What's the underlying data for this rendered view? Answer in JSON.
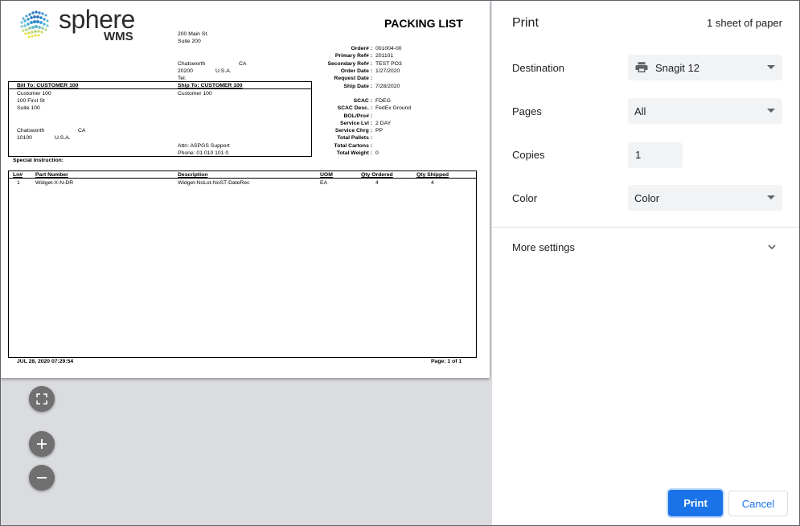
{
  "document": {
    "logo_text": "sphere",
    "logo_sub": "WMS",
    "title": "PACKING LIST",
    "address": {
      "line1": "200 Main St.",
      "line2": "Suite 200",
      "city": "Chatsworth",
      "state": "CA",
      "zip": "20200",
      "country": "U.S.A.",
      "tel_label": "Tel:"
    },
    "fields": [
      {
        "label": "Order# :",
        "value": "001004-00"
      },
      {
        "label": "Primary Ref# :",
        "value": "201101"
      },
      {
        "label": "Secondary Ref# :",
        "value": "TEST PO3"
      },
      {
        "label": "Order Date :",
        "value": "1/27/2020"
      },
      {
        "label": "Request Date :",
        "value": ""
      },
      {
        "label": "Ship Date :",
        "value": "7/28/2020"
      },
      {
        "label": "SCAC :",
        "value": "FDEG"
      },
      {
        "label": "SCAC Desc. :",
        "value": "FedEx Ground"
      },
      {
        "label": "BOL/Pro# :",
        "value": ""
      },
      {
        "label": "Service Lvl :",
        "value": "2 DAY"
      },
      {
        "label": "Service Chrg :",
        "value": "PP"
      },
      {
        "label": "Total Pallets :",
        "value": ""
      },
      {
        "label": "Total Cartons :",
        "value": ""
      },
      {
        "label": "Total Weight :",
        "value": "0"
      }
    ],
    "bill_to": {
      "header": "Bill To: CUSTOMER 100",
      "name": "Customer 100",
      "addr1": "100 First St",
      "addr2": "Suite 100",
      "city": "Chatsworth",
      "state": "CA",
      "zip": "10100",
      "country": "U.S.A."
    },
    "ship_to": {
      "header": "Ship To: CUSTOMER 100",
      "name": "Customer 100",
      "attn": "Attn: ASPGS Support",
      "phone": "Phone: 01 010 101 0"
    },
    "special_instruction": "Special Instruction:",
    "table": {
      "headers": [
        "Ln#",
        "Part Number",
        "Description",
        "UOM",
        "Qty Ordered",
        "Qty Shipped"
      ],
      "rows": [
        [
          "1",
          "Widget-X-N-DR",
          "Widget-NoLot-NoST-DateRec",
          "EA",
          "4",
          "4"
        ]
      ]
    },
    "footer_date": "JUL 28, 2020  07:29:54",
    "footer_page": "Page:   1 of   1"
  },
  "preview_controls": {
    "fit_icon": "fit-to-page-icon",
    "zoom_in_icon": "plus-icon",
    "zoom_out_icon": "minus-icon"
  },
  "settings": {
    "title": "Print",
    "sheets": "1 sheet of paper",
    "destination_label": "Destination",
    "destination_value": "Snagit 12",
    "pages_label": "Pages",
    "pages_value": "All",
    "copies_label": "Copies",
    "copies_value": "1",
    "color_label": "Color",
    "color_value": "Color",
    "more_settings": "More settings",
    "print_button": "Print",
    "cancel_button": "Cancel"
  },
  "colors": {
    "accent": "#1a73e8",
    "field_bg": "#f1f3f4",
    "preview_bg": "#dadce0"
  }
}
